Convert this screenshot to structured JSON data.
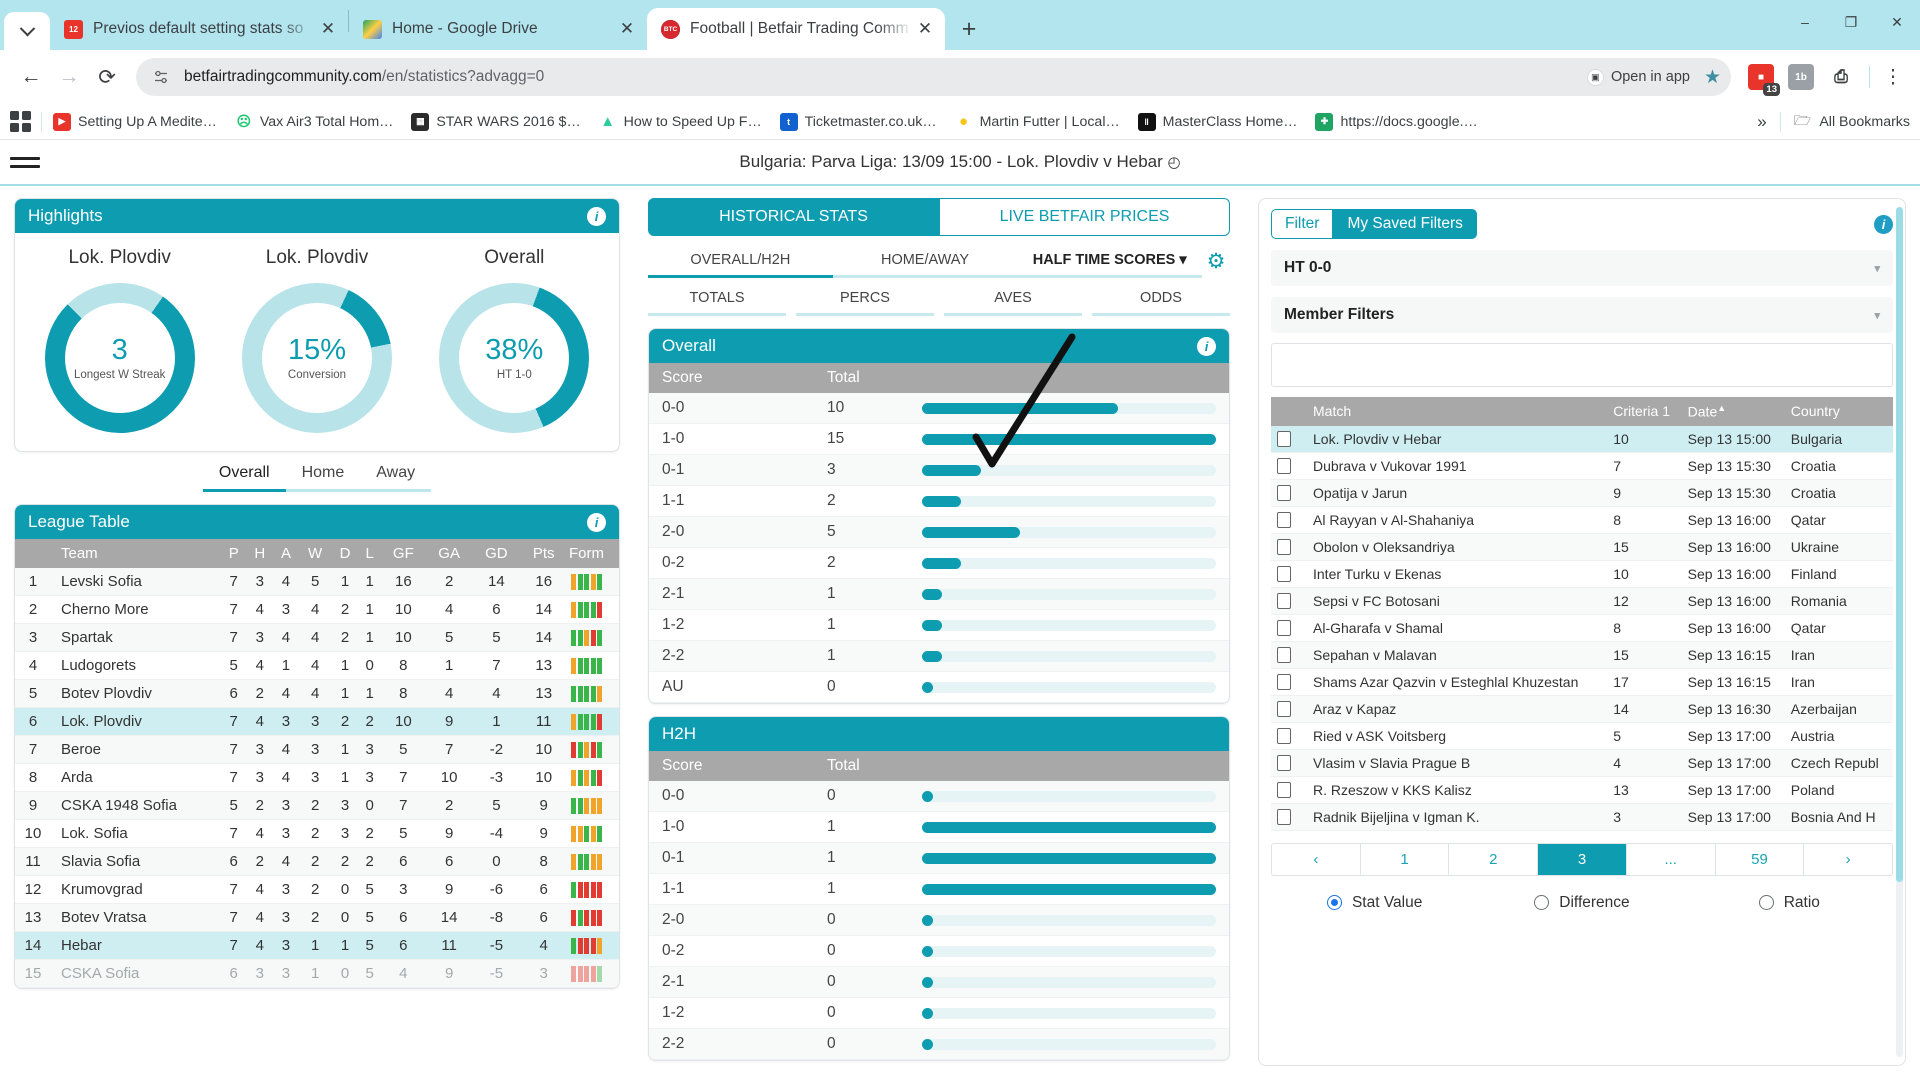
{
  "browser": {
    "tabs": [
      {
        "title": "Previos default setting stats so",
        "favicon": "calendar-icon",
        "active": false
      },
      {
        "title": "Home - Google Drive",
        "favicon": "drive-icon",
        "active": false
      },
      {
        "title": "Football | Betfair Trading Comm",
        "favicon": "btc-icon",
        "active": true
      }
    ],
    "new_tab_label": "+",
    "window_controls": {
      "minimize": "–",
      "maximize": "❐",
      "close": "✕"
    },
    "nav": {
      "back": "←",
      "forward": "→",
      "reload": "⟳"
    },
    "url_main": "betfairtradingcommunity.com",
    "url_path": "/en/statistics?advagg=0",
    "open_in_app": "Open in app",
    "bookmarks": [
      {
        "label": "Setting Up A Medite…",
        "color": "#e8342a",
        "glyph": "▶"
      },
      {
        "label": "Vax Air3 Total Hom…",
        "color": "#1ec773",
        "glyph": "◕"
      },
      {
        "label": "STAR WARS 2016 $…",
        "color": "#2b2b2b",
        "glyph": "▦"
      },
      {
        "label": "How to Speed Up F…",
        "color": "#2ecc9b",
        "glyph": "▲"
      },
      {
        "label": "Ticketmaster.co.uk…",
        "color": "#1161d0",
        "glyph": "t"
      },
      {
        "label": "Martin Futter | Local…",
        "color": "#f5c518",
        "glyph": "●"
      },
      {
        "label": "MasterClass Home…",
        "color": "#111111",
        "glyph": "‖"
      },
      {
        "label": "https://docs.google.…",
        "color": "#1fa463",
        "glyph": "✚"
      }
    ],
    "bookmarks_overflow": "»",
    "all_bookmarks": "All Bookmarks"
  },
  "page": {
    "match_title": "Bulgaria: Parva Liga: 13/09 15:00 - Lok. Plovdiv v Hebar",
    "clock_icon": "◴"
  },
  "highlights": {
    "title": "Highlights",
    "info_icon": "i",
    "donuts": [
      {
        "label": "Lok. Plovdiv",
        "value": "3",
        "sub": "Longest W Streak",
        "pct": 78
      },
      {
        "label": "Lok. Plovdiv",
        "value": "15%",
        "sub": "Conversion",
        "pct": 15
      },
      {
        "label": "Overall",
        "value": "38%",
        "sub": "HT 1-0",
        "pct": 38
      }
    ],
    "ha_tabs": [
      {
        "label": "Overall",
        "active": true
      },
      {
        "label": "Home",
        "active": false
      },
      {
        "label": "Away",
        "active": false
      }
    ]
  },
  "league_table": {
    "title": "League Table",
    "info_icon": "i",
    "columns": [
      "",
      "Team",
      "P",
      "H",
      "A",
      "W",
      "D",
      "L",
      "GF",
      "GA",
      "GD",
      "Pts",
      "Form"
    ],
    "rows": [
      {
        "pos": "1",
        "team": "Levski Sofia",
        "p": "7",
        "h": "3",
        "a": "4",
        "w": "5",
        "d": "1",
        "l": "1",
        "gf": "16",
        "ga": "2",
        "gd": "14",
        "pts": "16",
        "form": [
          "o",
          "g",
          "g",
          "o",
          "g"
        ],
        "hl": false
      },
      {
        "pos": "2",
        "team": "Cherno More",
        "p": "7",
        "h": "4",
        "a": "3",
        "w": "4",
        "d": "2",
        "l": "1",
        "gf": "10",
        "ga": "4",
        "gd": "6",
        "pts": "14",
        "form": [
          "o",
          "g",
          "g",
          "g",
          "r"
        ],
        "hl": false
      },
      {
        "pos": "3",
        "team": "Spartak",
        "p": "7",
        "h": "3",
        "a": "4",
        "w": "4",
        "d": "2",
        "l": "1",
        "gf": "10",
        "ga": "5",
        "gd": "5",
        "pts": "14",
        "form": [
          "g",
          "g",
          "o",
          "r",
          "g"
        ],
        "hl": false
      },
      {
        "pos": "4",
        "team": "Ludogorets",
        "p": "5",
        "h": "4",
        "a": "1",
        "w": "4",
        "d": "1",
        "l": "0",
        "gf": "8",
        "ga": "1",
        "gd": "7",
        "pts": "13",
        "form": [
          "o",
          "g",
          "g",
          "g",
          "g"
        ],
        "hl": false
      },
      {
        "pos": "5",
        "team": "Botev Plovdiv",
        "p": "6",
        "h": "2",
        "a": "4",
        "w": "4",
        "d": "1",
        "l": "1",
        "gf": "8",
        "ga": "4",
        "gd": "4",
        "pts": "13",
        "form": [
          "g",
          "g",
          "g",
          "g",
          "o"
        ],
        "hl": false
      },
      {
        "pos": "6",
        "team": "Lok. Plovdiv",
        "p": "7",
        "h": "4",
        "a": "3",
        "w": "3",
        "d": "2",
        "l": "2",
        "gf": "10",
        "ga": "9",
        "gd": "1",
        "pts": "11",
        "form": [
          "o",
          "g",
          "g",
          "g",
          "r"
        ],
        "hl": true
      },
      {
        "pos": "7",
        "team": "Beroe",
        "p": "7",
        "h": "3",
        "a": "4",
        "w": "3",
        "d": "1",
        "l": "3",
        "gf": "5",
        "ga": "7",
        "gd": "-2",
        "pts": "10",
        "form": [
          "r",
          "g",
          "o",
          "r",
          "g"
        ],
        "hl": false
      },
      {
        "pos": "8",
        "team": "Arda",
        "p": "7",
        "h": "3",
        "a": "4",
        "w": "3",
        "d": "1",
        "l": "3",
        "gf": "7",
        "ga": "10",
        "gd": "-3",
        "pts": "10",
        "form": [
          "o",
          "g",
          "o",
          "g",
          "r"
        ],
        "hl": false
      },
      {
        "pos": "9",
        "team": "CSKA 1948 Sofia",
        "p": "5",
        "h": "2",
        "a": "3",
        "w": "2",
        "d": "3",
        "l": "0",
        "gf": "7",
        "ga": "2",
        "gd": "5",
        "pts": "9",
        "form": [
          "g",
          "g",
          "o",
          "o",
          "o"
        ],
        "hl": false
      },
      {
        "pos": "10",
        "team": "Lok. Sofia",
        "p": "7",
        "h": "4",
        "a": "3",
        "w": "2",
        "d": "3",
        "l": "2",
        "gf": "5",
        "ga": "9",
        "gd": "-4",
        "pts": "9",
        "form": [
          "o",
          "o",
          "g",
          "o",
          "g"
        ],
        "hl": false
      },
      {
        "pos": "11",
        "team": "Slavia Sofia",
        "p": "6",
        "h": "2",
        "a": "4",
        "w": "2",
        "d": "2",
        "l": "2",
        "gf": "6",
        "ga": "6",
        "gd": "0",
        "pts": "8",
        "form": [
          "o",
          "g",
          "g",
          "o",
          "o"
        ],
        "hl": false
      },
      {
        "pos": "12",
        "team": "Krumovgrad",
        "p": "7",
        "h": "4",
        "a": "3",
        "w": "2",
        "d": "0",
        "l": "5",
        "gf": "3",
        "ga": "9",
        "gd": "-6",
        "pts": "6",
        "form": [
          "g",
          "r",
          "r",
          "r",
          "r"
        ],
        "hl": false
      },
      {
        "pos": "13",
        "team": "Botev Vratsa",
        "p": "7",
        "h": "4",
        "a": "3",
        "w": "2",
        "d": "0",
        "l": "5",
        "gf": "6",
        "ga": "14",
        "gd": "-8",
        "pts": "6",
        "form": [
          "r",
          "g",
          "r",
          "r",
          "r"
        ],
        "hl": false
      },
      {
        "pos": "14",
        "team": "Hebar",
        "p": "7",
        "h": "4",
        "a": "3",
        "w": "1",
        "d": "1",
        "l": "5",
        "gf": "6",
        "ga": "11",
        "gd": "-5",
        "pts": "4",
        "form": [
          "g",
          "r",
          "r",
          "r",
          "o"
        ],
        "hl": true
      },
      {
        "pos": "15",
        "team": "CSKA Sofia",
        "p": "6",
        "h": "3",
        "a": "3",
        "w": "1",
        "d": "0",
        "l": "5",
        "gf": "4",
        "ga": "9",
        "gd": "-5",
        "pts": "3",
        "form": [
          "r",
          "r",
          "r",
          "r",
          "g"
        ],
        "faded": true
      }
    ]
  },
  "stats": {
    "mode_tabs": [
      {
        "label": "HISTORICAL STATS",
        "active": true
      },
      {
        "label": "LIVE BETFAIR PRICES",
        "active": false
      }
    ],
    "tier1": [
      {
        "label": "OVERALL/H2H",
        "active": true,
        "bold": false
      },
      {
        "label": "HOME/AWAY",
        "active": false,
        "bold": false
      },
      {
        "label": "HALF TIME SCORES",
        "active": false,
        "bold": true,
        "caret": "▾"
      }
    ],
    "gear_icon": "⚙",
    "tier2": [
      {
        "label": "TOTALS",
        "active": true
      },
      {
        "label": "PERCS",
        "active": false
      },
      {
        "label": "AVES",
        "active": false
      },
      {
        "label": "ODDS",
        "active": false
      }
    ]
  },
  "chart_data": [
    {
      "type": "bar",
      "title": "Overall",
      "info_icon": "i",
      "columns": [
        "Score",
        "Total",
        ""
      ],
      "categories": [
        "0-0",
        "1-0",
        "0-1",
        "1-1",
        "2-0",
        "0-2",
        "2-1",
        "1-2",
        "2-2",
        "AU"
      ],
      "values": [
        10,
        15,
        3,
        2,
        5,
        2,
        1,
        1,
        1,
        0
      ],
      "xlabel": "Score",
      "ylabel": "Total",
      "ylim": [
        0,
        15
      ],
      "grid": false,
      "legend": "none",
      "orientation": "horizontal"
    },
    {
      "type": "bar",
      "title": "H2H",
      "info_icon": "i",
      "columns": [
        "Score",
        "Total",
        ""
      ],
      "categories": [
        "0-0",
        "1-0",
        "0-1",
        "1-1",
        "2-0",
        "0-2",
        "2-1",
        "1-2",
        "2-2"
      ],
      "values": [
        0,
        1,
        1,
        1,
        0,
        0,
        0,
        0,
        0
      ],
      "xlabel": "Score",
      "ylabel": "Total",
      "ylim": [
        0,
        1
      ],
      "grid": false,
      "legend": "none",
      "orientation": "horizontal"
    }
  ],
  "filter": {
    "tabs": [
      {
        "label": "Filter",
        "active": false
      },
      {
        "label": "My Saved Filters",
        "active": true
      }
    ],
    "info_icon": "i",
    "selects": [
      {
        "label": "HT 0-0",
        "caret": "▾"
      },
      {
        "label": "Member Filters",
        "caret": "▾"
      }
    ],
    "notes_value": "",
    "matches": {
      "columns": [
        "",
        "Match",
        "Criteria 1",
        "Date",
        "Country"
      ],
      "sort_col": "Date",
      "sort_caret": "▲",
      "rows": [
        {
          "match": "Lok. Plovdiv v Hebar",
          "criteria": "10",
          "date": "Sep 13 15:00",
          "country": "Bulgaria",
          "hl": true
        },
        {
          "match": "Dubrava v Vukovar 1991",
          "criteria": "7",
          "date": "Sep 13 15:30",
          "country": "Croatia",
          "hl": false
        },
        {
          "match": "Opatija v Jarun",
          "criteria": "9",
          "date": "Sep 13 15:30",
          "country": "Croatia",
          "hl": false
        },
        {
          "match": "Al Rayyan v Al-Shahaniya",
          "criteria": "8",
          "date": "Sep 13 16:00",
          "country": "Qatar",
          "hl": false
        },
        {
          "match": "Obolon v Oleksandriya",
          "criteria": "15",
          "date": "Sep 13 16:00",
          "country": "Ukraine",
          "hl": false
        },
        {
          "match": "Inter Turku v Ekenas",
          "criteria": "10",
          "date": "Sep 13 16:00",
          "country": "Finland",
          "hl": false
        },
        {
          "match": "Sepsi v FC Botosani",
          "criteria": "12",
          "date": "Sep 13 16:00",
          "country": "Romania",
          "hl": false
        },
        {
          "match": "Al-Gharafa v Shamal",
          "criteria": "8",
          "date": "Sep 13 16:00",
          "country": "Qatar",
          "hl": false
        },
        {
          "match": "Sepahan v Malavan",
          "criteria": "15",
          "date": "Sep 13 16:15",
          "country": "Iran",
          "hl": false
        },
        {
          "match": "Shams Azar Qazvin v Esteghlal Khuzestan",
          "criteria": "17",
          "date": "Sep 13 16:15",
          "country": "Iran",
          "hl": false
        },
        {
          "match": "Araz v Kapaz",
          "criteria": "14",
          "date": "Sep 13 16:30",
          "country": "Azerbaijan",
          "hl": false
        },
        {
          "match": "Ried v ASK Voitsberg",
          "criteria": "5",
          "date": "Sep 13 17:00",
          "country": "Austria",
          "hl": false
        },
        {
          "match": "Vlasim v Slavia Prague B",
          "criteria": "4",
          "date": "Sep 13 17:00",
          "country": "Czech Republ",
          "hl": false
        },
        {
          "match": "R. Rzeszow v KKS Kalisz",
          "criteria": "13",
          "date": "Sep 13 17:00",
          "country": "Poland",
          "hl": false
        },
        {
          "match": "Radnik Bijeljina v Igman K.",
          "criteria": "3",
          "date": "Sep 13 17:00",
          "country": "Bosnia And H",
          "hl": false
        }
      ]
    },
    "pagination": [
      {
        "label": "‹",
        "active": false
      },
      {
        "label": "1",
        "active": false
      },
      {
        "label": "2",
        "active": false
      },
      {
        "label": "3",
        "active": true
      },
      {
        "label": "...",
        "active": false
      },
      {
        "label": "59",
        "active": false
      },
      {
        "label": "›",
        "active": false
      }
    ],
    "radios": [
      {
        "label": "Stat Value",
        "selected": true
      },
      {
        "label": "Difference",
        "selected": false
      },
      {
        "label": "Ratio",
        "selected": false
      }
    ]
  },
  "colors": {
    "teal": "#0e9cb0",
    "teal_light": "#b3e5ef",
    "header_gray": "#a8a8a8",
    "highlight_row": "#cfeef2",
    "accent_blue": "#1a73e8"
  }
}
